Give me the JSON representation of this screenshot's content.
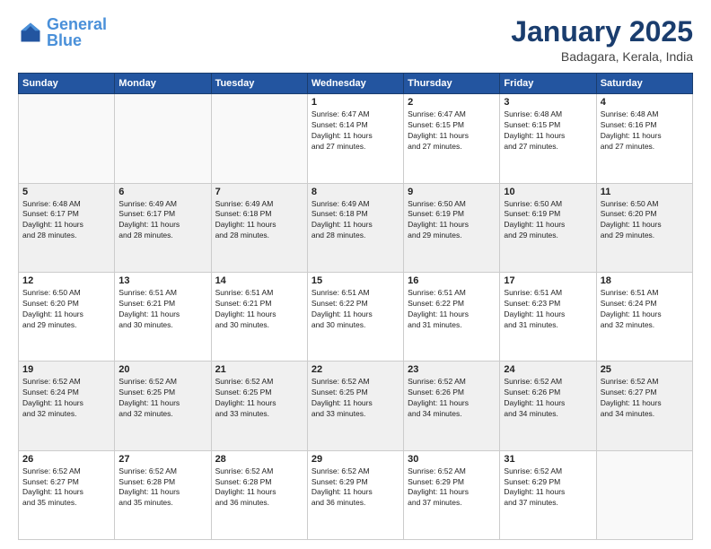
{
  "header": {
    "logo_general": "General",
    "logo_blue": "Blue",
    "title": "January 2025",
    "subtitle": "Badagara, Kerala, India"
  },
  "days_of_week": [
    "Sunday",
    "Monday",
    "Tuesday",
    "Wednesday",
    "Thursday",
    "Friday",
    "Saturday"
  ],
  "weeks": [
    [
      {
        "day": "",
        "info": ""
      },
      {
        "day": "",
        "info": ""
      },
      {
        "day": "",
        "info": ""
      },
      {
        "day": "1",
        "info": "Sunrise: 6:47 AM\nSunset: 6:14 PM\nDaylight: 11 hours\nand 27 minutes."
      },
      {
        "day": "2",
        "info": "Sunrise: 6:47 AM\nSunset: 6:15 PM\nDaylight: 11 hours\nand 27 minutes."
      },
      {
        "day": "3",
        "info": "Sunrise: 6:48 AM\nSunset: 6:15 PM\nDaylight: 11 hours\nand 27 minutes."
      },
      {
        "day": "4",
        "info": "Sunrise: 6:48 AM\nSunset: 6:16 PM\nDaylight: 11 hours\nand 27 minutes."
      }
    ],
    [
      {
        "day": "5",
        "info": "Sunrise: 6:48 AM\nSunset: 6:17 PM\nDaylight: 11 hours\nand 28 minutes."
      },
      {
        "day": "6",
        "info": "Sunrise: 6:49 AM\nSunset: 6:17 PM\nDaylight: 11 hours\nand 28 minutes."
      },
      {
        "day": "7",
        "info": "Sunrise: 6:49 AM\nSunset: 6:18 PM\nDaylight: 11 hours\nand 28 minutes."
      },
      {
        "day": "8",
        "info": "Sunrise: 6:49 AM\nSunset: 6:18 PM\nDaylight: 11 hours\nand 28 minutes."
      },
      {
        "day": "9",
        "info": "Sunrise: 6:50 AM\nSunset: 6:19 PM\nDaylight: 11 hours\nand 29 minutes."
      },
      {
        "day": "10",
        "info": "Sunrise: 6:50 AM\nSunset: 6:19 PM\nDaylight: 11 hours\nand 29 minutes."
      },
      {
        "day": "11",
        "info": "Sunrise: 6:50 AM\nSunset: 6:20 PM\nDaylight: 11 hours\nand 29 minutes."
      }
    ],
    [
      {
        "day": "12",
        "info": "Sunrise: 6:50 AM\nSunset: 6:20 PM\nDaylight: 11 hours\nand 29 minutes."
      },
      {
        "day": "13",
        "info": "Sunrise: 6:51 AM\nSunset: 6:21 PM\nDaylight: 11 hours\nand 30 minutes."
      },
      {
        "day": "14",
        "info": "Sunrise: 6:51 AM\nSunset: 6:21 PM\nDaylight: 11 hours\nand 30 minutes."
      },
      {
        "day": "15",
        "info": "Sunrise: 6:51 AM\nSunset: 6:22 PM\nDaylight: 11 hours\nand 30 minutes."
      },
      {
        "day": "16",
        "info": "Sunrise: 6:51 AM\nSunset: 6:22 PM\nDaylight: 11 hours\nand 31 minutes."
      },
      {
        "day": "17",
        "info": "Sunrise: 6:51 AM\nSunset: 6:23 PM\nDaylight: 11 hours\nand 31 minutes."
      },
      {
        "day": "18",
        "info": "Sunrise: 6:51 AM\nSunset: 6:24 PM\nDaylight: 11 hours\nand 32 minutes."
      }
    ],
    [
      {
        "day": "19",
        "info": "Sunrise: 6:52 AM\nSunset: 6:24 PM\nDaylight: 11 hours\nand 32 minutes."
      },
      {
        "day": "20",
        "info": "Sunrise: 6:52 AM\nSunset: 6:25 PM\nDaylight: 11 hours\nand 32 minutes."
      },
      {
        "day": "21",
        "info": "Sunrise: 6:52 AM\nSunset: 6:25 PM\nDaylight: 11 hours\nand 33 minutes."
      },
      {
        "day": "22",
        "info": "Sunrise: 6:52 AM\nSunset: 6:25 PM\nDaylight: 11 hours\nand 33 minutes."
      },
      {
        "day": "23",
        "info": "Sunrise: 6:52 AM\nSunset: 6:26 PM\nDaylight: 11 hours\nand 34 minutes."
      },
      {
        "day": "24",
        "info": "Sunrise: 6:52 AM\nSunset: 6:26 PM\nDaylight: 11 hours\nand 34 minutes."
      },
      {
        "day": "25",
        "info": "Sunrise: 6:52 AM\nSunset: 6:27 PM\nDaylight: 11 hours\nand 34 minutes."
      }
    ],
    [
      {
        "day": "26",
        "info": "Sunrise: 6:52 AM\nSunset: 6:27 PM\nDaylight: 11 hours\nand 35 minutes."
      },
      {
        "day": "27",
        "info": "Sunrise: 6:52 AM\nSunset: 6:28 PM\nDaylight: 11 hours\nand 35 minutes."
      },
      {
        "day": "28",
        "info": "Sunrise: 6:52 AM\nSunset: 6:28 PM\nDaylight: 11 hours\nand 36 minutes."
      },
      {
        "day": "29",
        "info": "Sunrise: 6:52 AM\nSunset: 6:29 PM\nDaylight: 11 hours\nand 36 minutes."
      },
      {
        "day": "30",
        "info": "Sunrise: 6:52 AM\nSunset: 6:29 PM\nDaylight: 11 hours\nand 37 minutes."
      },
      {
        "day": "31",
        "info": "Sunrise: 6:52 AM\nSunset: 6:29 PM\nDaylight: 11 hours\nand 37 minutes."
      },
      {
        "day": "",
        "info": ""
      }
    ]
  ]
}
